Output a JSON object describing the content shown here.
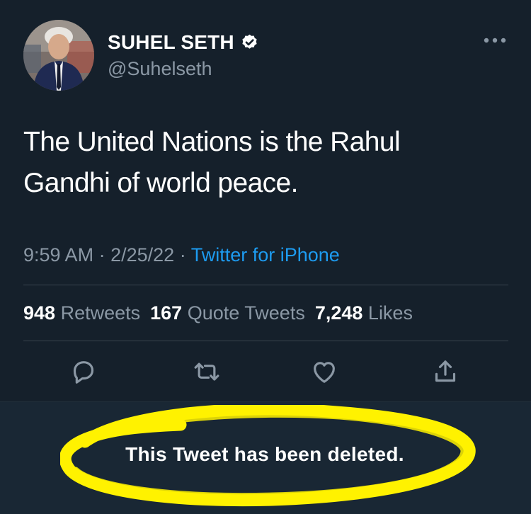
{
  "tweet": {
    "author": {
      "display_name": "SUHEL SETH",
      "handle": "@Suhelseth",
      "verified": true
    },
    "text_line1": "The United Nations is the Rahul",
    "text_line2": "Gandhi of world peace.",
    "time": "9:59 AM",
    "date": "2/25/22",
    "separator": "·",
    "source": "Twitter for iPhone",
    "stats": {
      "retweets_count": "948",
      "retweets_label": "Retweets",
      "quotes_count": "167",
      "quotes_label": "Quote Tweets",
      "likes_count": "7,248",
      "likes_label": "Likes"
    },
    "actions": [
      "reply-icon",
      "retweet-icon",
      "like-icon",
      "share-icon"
    ]
  },
  "notice": {
    "text": "This Tweet has been deleted.",
    "highlight_color": "#fff200"
  },
  "colors": {
    "background": "#15202b",
    "secondary_text": "#8b98a5",
    "accent": "#1d9bf0",
    "divider": "#38444d"
  }
}
